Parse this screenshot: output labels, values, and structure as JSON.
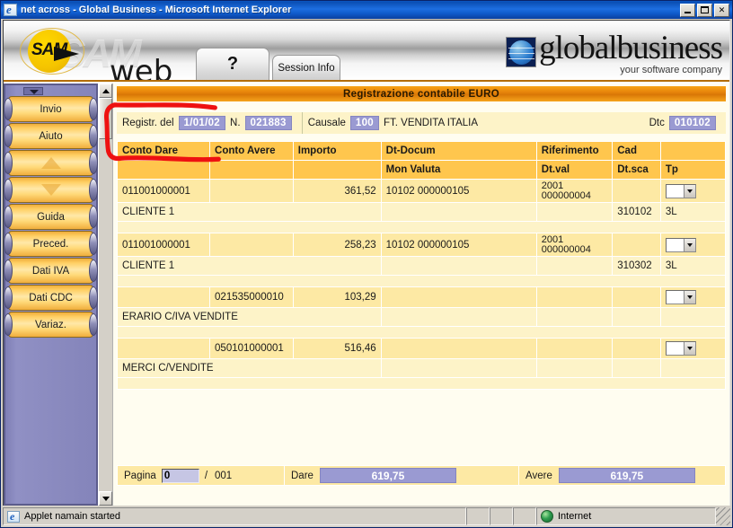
{
  "window": {
    "title": "net across - Global Business - Microsoft Internet Explorer",
    "icon": "ie-icon",
    "minimize_label": "Minimize",
    "maximize_label": "Maximize",
    "close_label": "✕"
  },
  "brand": {
    "sam_logo": "SAM",
    "ghost_logo": "SAM",
    "web_word": "web",
    "global_word": "globalbusiness",
    "global_tagline": "your software company",
    "globe_icon": "globe-icon"
  },
  "tabs": [
    {
      "label": "?",
      "name": "tab-help"
    },
    {
      "label": "Session Info",
      "name": "tab-session-info"
    }
  ],
  "sidebar": {
    "collapse_icon": "triangle-down-icon",
    "items": [
      {
        "label": "Invio",
        "name": "sidebar-button-invio",
        "type": "text"
      },
      {
        "label": "Aiuto",
        "name": "sidebar-button-aiuto",
        "type": "text"
      },
      {
        "label": "",
        "name": "sidebar-button-up",
        "type": "up-arrow-icon"
      },
      {
        "label": "",
        "name": "sidebar-button-down",
        "type": "down-arrow-icon"
      },
      {
        "label": "Guida",
        "name": "sidebar-button-guida",
        "type": "text"
      },
      {
        "label": "Preced.",
        "name": "sidebar-button-preced",
        "type": "text"
      },
      {
        "label": "Dati IVA",
        "name": "sidebar-button-dati-iva",
        "type": "text"
      },
      {
        "label": "Dati CDC",
        "name": "sidebar-button-dati-cdc",
        "type": "text"
      },
      {
        "label": "Variaz.",
        "name": "sidebar-button-variaz",
        "type": "text"
      }
    ]
  },
  "scrollbar": {
    "up_icon": "scroll-up-icon",
    "down_icon": "scroll-down-icon"
  },
  "form": {
    "title": "Registrazione contabile  EURO",
    "registration": {
      "date_label": "Registr. del",
      "date_value": "1/01/02",
      "number_label": "N.",
      "number_value": "021883",
      "causale_label": "Causale",
      "causale_code": "100",
      "causale_desc": "FT. VENDITA ITALIA",
      "dtc_label": "Dtc",
      "dtc_value": "010102"
    },
    "headers_row1": [
      "Conto Dare",
      "Conto Avere",
      "Importo",
      "Dt-Docum",
      "Riferimento",
      "Cad",
      ""
    ],
    "headers_row2": [
      "",
      "",
      "",
      "Mon Valuta",
      "Dt.val",
      "Dt.sca",
      "Tp"
    ],
    "rows": [
      {
        "conto_dare": "011001000001",
        "conto_avere": "",
        "importo": "361,52",
        "dt_docum": "10102   000000105",
        "riferimento_1": "2001",
        "riferimento_2": "000000004",
        "cad": "",
        "tp_combo": "combo-dropdown",
        "description": "CLIENTE 1",
        "mon_valuta": "",
        "dt_val": "",
        "dt_sca": "310102",
        "tp": "3L"
      },
      {
        "conto_dare": "011001000001",
        "conto_avere": "",
        "importo": "258,23",
        "dt_docum": "10102   000000105",
        "riferimento_1": "2001",
        "riferimento_2": "000000004",
        "cad": "",
        "tp_combo": "combo-dropdown",
        "description": "CLIENTE 1",
        "mon_valuta": "",
        "dt_val": "",
        "dt_sca": "310302",
        "tp": "3L"
      },
      {
        "conto_dare": "",
        "conto_avere": "021535000010",
        "importo": "103,29",
        "dt_docum": "",
        "riferimento_1": "",
        "riferimento_2": "",
        "cad": "",
        "tp_combo": "combo-dropdown",
        "description": "ERARIO C/IVA VENDITE",
        "mon_valuta": "",
        "dt_val": "",
        "dt_sca": "",
        "tp": ""
      },
      {
        "conto_dare": "",
        "conto_avere": "050101000001",
        "importo": "516,46",
        "dt_docum": "",
        "riferimento_1": "",
        "riferimento_2": "",
        "cad": "",
        "tp_combo": "combo-dropdown",
        "description": "MERCI C/VENDITE",
        "mon_valuta": "",
        "dt_val": "",
        "dt_sca": "",
        "tp": ""
      }
    ],
    "footer": {
      "pagina_label": "Pagina",
      "pagina_value": "0",
      "pagina_sep": "/",
      "pagina_total": "001",
      "dare_label": "Dare",
      "dare_total": "619,75",
      "avere_label": "Avere",
      "avere_total": "619,75"
    }
  },
  "statusbar": {
    "message": "Applet namain started",
    "zone": "Internet",
    "zone_icon": "globe-icon",
    "page_icon": "ie-icon"
  },
  "colors": {
    "title_bar_blue": "#1d6ee0",
    "form_title_orange": "#e8850b",
    "grid_header_orange": "#ffc64d",
    "grid_row_cream": "#fde9a4",
    "grid_desc_cream": "#fdf3c8",
    "value_badge_purple": "#9a9ad2",
    "sidebar_purple": "#8484ba",
    "sidebar_button_gold": "#ffd064",
    "annotation_red": "#ee1111"
  }
}
